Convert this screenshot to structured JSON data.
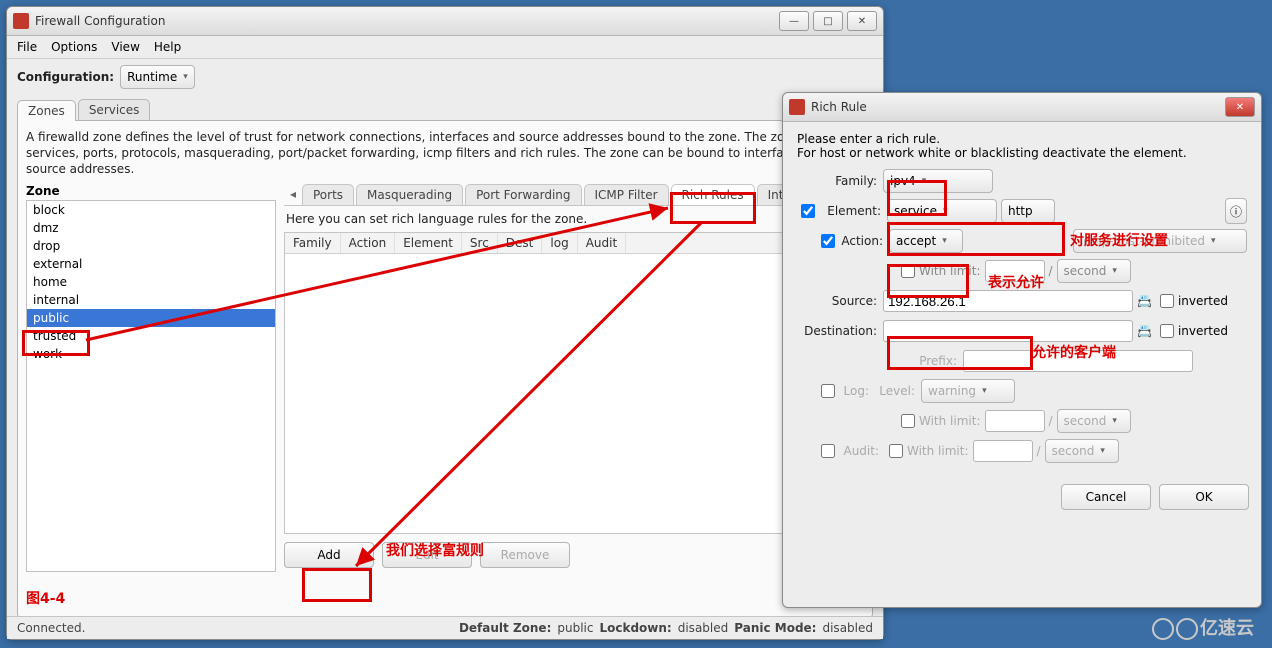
{
  "main": {
    "title": "Firewall Configuration",
    "menu": [
      "File",
      "Options",
      "View",
      "Help"
    ],
    "config_label": "Configuration:",
    "config_value": "Runtime",
    "tabs": [
      "Zones",
      "Services"
    ],
    "zone_description": "A firewalld zone defines the level of trust for network connections, interfaces and source addresses bound to the zone. The zone combines services, ports, protocols, masquerading, port/packet forwarding, icmp filters and rich rules. The zone can be bound to interfaces and source addresses.",
    "zone_header": "Zone",
    "zones": [
      "block",
      "dmz",
      "drop",
      "external",
      "home",
      "internal",
      "public",
      "trusted",
      "work"
    ],
    "zone_selected_index": 6,
    "subtabs": [
      "Ports",
      "Masquerading",
      "Port Forwarding",
      "ICMP Filter",
      "Rich Rules",
      "Interfaces"
    ],
    "subtab_active_index": 4,
    "rich_desc": "Here you can set rich language rules for the zone.",
    "columns": [
      "Family",
      "Action",
      "Element",
      "Src",
      "Dest",
      "log",
      "Audit"
    ],
    "buttons": {
      "add": "Add",
      "edit": "Edit",
      "remove": "Remove"
    }
  },
  "status": {
    "connected": "Connected.",
    "defzone_l": "Default Zone:",
    "defzone_v": "public",
    "lock_l": "Lockdown:",
    "lock_v": "disabled",
    "panic_l": "Panic Mode:",
    "panic_v": "disabled"
  },
  "dialog": {
    "title": "Rich Rule",
    "intro1": "Please enter a rich rule.",
    "intro2": "For host or network white or blacklisting deactivate the element.",
    "family_l": "Family:",
    "family_v": "ipv4",
    "element_l": "Element:",
    "element_type": "service",
    "element_val": "http",
    "action_l": "Action:",
    "action_v": "accept",
    "action_extra": "icmp-host-prohibited",
    "withlimit": "With limit:",
    "second": "second",
    "slash": "/",
    "source_l": "Source:",
    "source_v": "192.168.26.1",
    "inverted": "inverted",
    "dest_l": "Destination:",
    "prefix_l": "Prefix:",
    "log_l": "Log:",
    "level_l": "Level:",
    "level_v": "warning",
    "audit_l": "Audit:",
    "cancel": "Cancel",
    "ok": "OK"
  },
  "annotations": {
    "fig": "图4-4",
    "select_rich": "我们选择富规则",
    "svc_set": "对服务进行设置",
    "allow": "表示允许",
    "client": "允许的客户端"
  },
  "watermark": "亿速云"
}
